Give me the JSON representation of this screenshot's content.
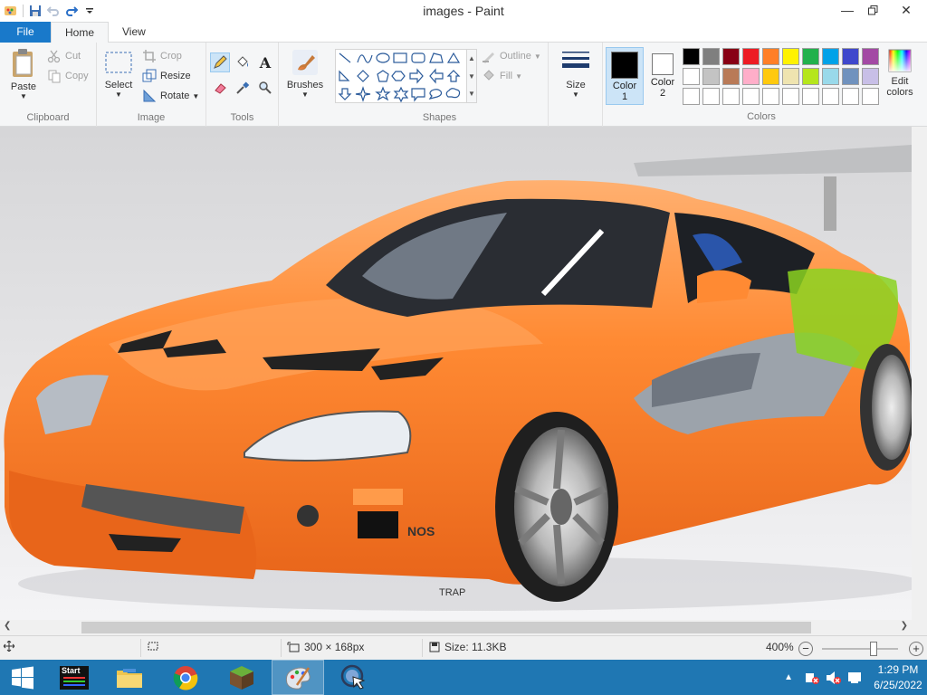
{
  "window": {
    "title": "images - Paint"
  },
  "tabs": {
    "file": "File",
    "home": "Home",
    "view": "View"
  },
  "clipboard": {
    "paste": "Paste",
    "cut": "Cut",
    "copy": "Copy",
    "label": "Clipboard"
  },
  "image": {
    "select": "Select",
    "crop": "Crop",
    "resize": "Resize",
    "rotate": "Rotate",
    "label": "Image"
  },
  "tools": {
    "label": "Tools",
    "selected": "pencil"
  },
  "brushes": {
    "label": "Brushes"
  },
  "shapes": {
    "outline": "Outline",
    "fill": "Fill",
    "label": "Shapes"
  },
  "size": {
    "label": "Size"
  },
  "colors": {
    "color1_label": "Color",
    "color1_index": "1",
    "color2_label": "Color",
    "color2_index": "2",
    "edit": "Edit colors",
    "edit_line1": "Edit",
    "edit_line2": "colors",
    "label": "Colors",
    "color1_value": "#000000",
    "color2_value": "#ffffff",
    "row1": [
      "#000000",
      "#7f7f7f",
      "#880015",
      "#ed1c24",
      "#ff7f27",
      "#fff200",
      "#22b14c",
      "#00a2e8",
      "#3f48cc",
      "#a349a4"
    ],
    "row2": [
      "#ffffff",
      "#c3c3c3",
      "#b97a57",
      "#ffaec9",
      "#ffc90e",
      "#efe4b0",
      "#b5e61d",
      "#99d9ea",
      "#7092be",
      "#c8bfe7"
    ]
  },
  "status": {
    "dimensions": "300 × 168px",
    "size": "Size: 11.3KB",
    "zoom": "400%",
    "zoom_fraction": 0.68
  },
  "taskbar": {
    "start_label": "Start",
    "time": "1:29 PM",
    "date": "6/25/2022"
  },
  "canvas": {
    "subject": "orange sports car",
    "body_color": "#ff7f27"
  }
}
